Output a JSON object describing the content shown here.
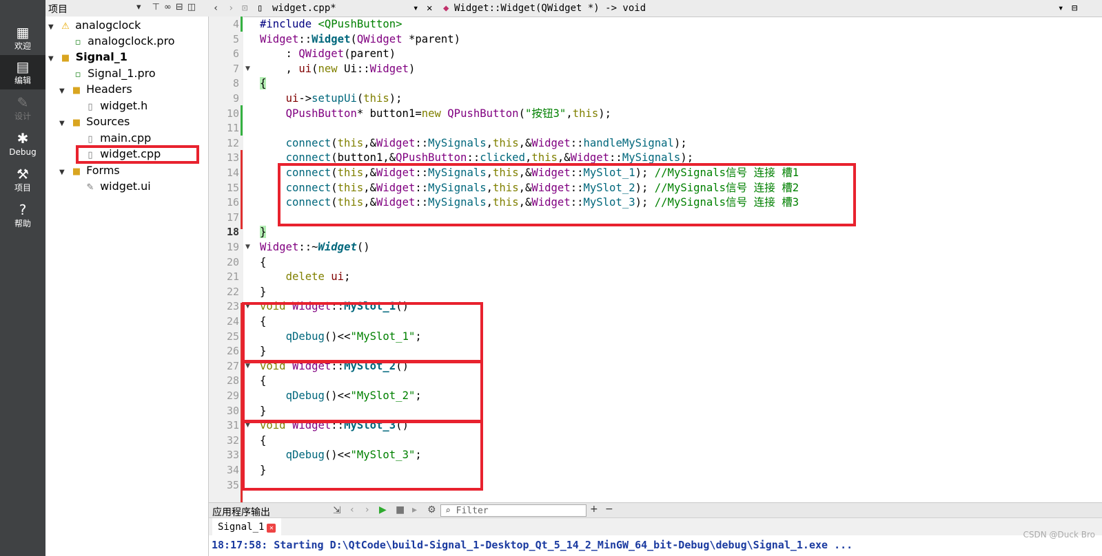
{
  "mode_bar": {
    "items": [
      {
        "label": "欢迎",
        "icon": "grid-icon"
      },
      {
        "label": "编辑",
        "icon": "document-icon"
      },
      {
        "label": "设计",
        "icon": "pencil-icon"
      },
      {
        "label": "Debug",
        "icon": "bug-icon"
      },
      {
        "label": "项目",
        "icon": "wrench-icon"
      },
      {
        "label": "帮助",
        "icon": "help-icon"
      }
    ]
  },
  "project_panel": {
    "title": "项目",
    "tree": [
      {
        "label": "analogclock",
        "icon": "warning-icon"
      },
      {
        "label": "analogclock.pro",
        "icon": "pro-file-icon"
      },
      {
        "label": "Signal_1",
        "icon": "project-folder-icon"
      },
      {
        "label": "Signal_1.pro",
        "icon": "pro-file-icon"
      },
      {
        "label": "Headers",
        "icon": "headers-folder-icon"
      },
      {
        "label": "widget.h",
        "icon": "header-file-icon"
      },
      {
        "label": "Sources",
        "icon": "sources-folder-icon"
      },
      {
        "label": "main.cpp",
        "icon": "cpp-file-icon"
      },
      {
        "label": "widget.cpp",
        "icon": "cpp-file-icon"
      },
      {
        "label": "Forms",
        "icon": "forms-folder-icon"
      },
      {
        "label": "widget.ui",
        "icon": "ui-file-icon"
      }
    ]
  },
  "editor_header": {
    "file": "widget.cpp*",
    "symbol": "Widget::Widget(QWidget *) -> void"
  },
  "editor": {
    "line_numbers": [
      "4",
      "5",
      "6",
      "7",
      "8",
      "9",
      "10",
      "11",
      "12",
      "13",
      "14",
      "15",
      "16",
      "17",
      "18",
      "19",
      "20",
      "21",
      "22",
      "23",
      "24",
      "25",
      "26",
      "27",
      "28",
      "29",
      "30",
      "31",
      "32",
      "33",
      "34",
      "35"
    ],
    "lines": {
      "l4": {
        "a": "#include ",
        "b": "<QPushButton>"
      },
      "l5": {
        "a": "Widget",
        "b": "::",
        "c": "Widget",
        "d": "(",
        "e": "QWidget",
        "f": " *parent)"
      },
      "l6": {
        "a": "    : ",
        "b": "QWidget",
        "c": "(parent)"
      },
      "l7": {
        "a": "    , ",
        "b": "ui",
        "c": "(",
        "d": "new",
        "e": " Ui::",
        "f": "Widget",
        ")": ")"
      },
      "l8": {
        "a": "{"
      },
      "l9": {
        "a": "    ",
        "b": "ui",
        "c": "->",
        "d": "setupUi",
        "e": "(",
        "f": "this",
        "g": ");"
      },
      "l10": {
        "a": "    ",
        "b": "QPushButton",
        "c": "* button1=",
        "d": "new",
        "e": " ",
        "f": "QPushButton",
        "g": "(",
        "h": "\"按钮3\"",
        "i": ",",
        "j": "this",
        "k": ");"
      },
      "l12": {
        "a": "    ",
        "b": "connect",
        "c": "(",
        "d": "this",
        "e": ",&",
        "f": "Widget",
        "g": "::",
        "h": "MySignals",
        "i": ",",
        "j": "this",
        "k": ",&",
        "l": "Widget",
        "m": "::",
        "n": "handleMySignal",
        "o": ");"
      },
      "l13": {
        "a": "    ",
        "b": "connect",
        "c": "(button1,&",
        "d": "QPushButton",
        "e": "::",
        "f": "clicked",
        "g": ",",
        "h": "this",
        "i": ",&",
        "j": "Widget",
        "k": "::",
        "l": "MySignals",
        "m": ");"
      },
      "l14": {
        "a": "    ",
        "b": "connect",
        "c": "(",
        "d": "this",
        "e": ",&",
        "f": "Widget",
        "g": "::",
        "h": "MySignals",
        "i": ",",
        "j": "this",
        "k": ",&",
        "l": "Widget",
        "m": "::",
        "n": "MySlot_1",
        "o": "); ",
        "p": "//MySignals信号 连接 槽1"
      },
      "l15": {
        "a": "    ",
        "b": "connect",
        "c": "(",
        "d": "this",
        "e": ",&",
        "f": "Widget",
        "g": "::",
        "h": "MySignals",
        "i": ",",
        "j": "this",
        "k": ",&",
        "l": "Widget",
        "m": "::",
        "n": "MySlot_2",
        "o": "); ",
        "p": "//MySignals信号 连接 槽2"
      },
      "l16": {
        "a": "    ",
        "b": "connect",
        "c": "(",
        "d": "this",
        "e": ",&",
        "f": "Widget",
        "g": "::",
        "h": "MySignals",
        "i": ",",
        "j": "this",
        "k": ",&",
        "l": "Widget",
        "m": "::",
        "n": "MySlot_3",
        "o": "); ",
        "p": "//MySignals信号 连接 槽3"
      },
      "l18": {
        "a": "}"
      },
      "l19": {
        "a": "Widget",
        "b": "::~",
        "c": "Widget",
        "d": "()"
      },
      "l20": {
        "a": "{"
      },
      "l21": {
        "a": "    ",
        "b": "delete",
        "c": " ",
        "d": "ui",
        ";": ";"
      },
      "l22": {
        "a": "}"
      },
      "l23": {
        "a": "void",
        "b": " ",
        "c": "Widget",
        "d": "::",
        "e": "MySlot_1",
        "f": "()"
      },
      "l24": {
        "a": "{"
      },
      "l25": {
        "a": "    ",
        "b": "qDebug",
        "c": "()<<",
        "d": "\"MySlot_1\"",
        "e": ";"
      },
      "l26": {
        "a": "}"
      },
      "l27": {
        "a": "void",
        "b": " ",
        "c": "Widget",
        "d": "::",
        "e": "MySlot_2",
        "f": "()"
      },
      "l28": {
        "a": "{"
      },
      "l29": {
        "a": "    ",
        "b": "qDebug",
        "c": "()<<",
        "d": "\"MySlot_2\"",
        "e": ";"
      },
      "l30": {
        "a": "}"
      },
      "l31": {
        "a": "void",
        "b": " ",
        "c": "Widget",
        "d": "::",
        "e": "MySlot_3",
        "f": "()"
      },
      "l32": {
        "a": "{"
      },
      "l33": {
        "a": "    ",
        "b": "qDebug",
        "c": "()<<",
        "d": "\"MySlot_3\"",
        "e": ";"
      },
      "l34": {
        "a": "}"
      }
    }
  },
  "output_pane": {
    "title": "应用程序输出",
    "filter_placeholder": "Filter",
    "tab_label": "Signal_1",
    "text": "18:17:58: Starting D:\\QtCode\\build-Signal_1-Desktop_Qt_5_14_2_MinGW_64_bit-Debug\\debug\\Signal_1.exe ..."
  },
  "watermark": "CSDN @Duck Bro"
}
